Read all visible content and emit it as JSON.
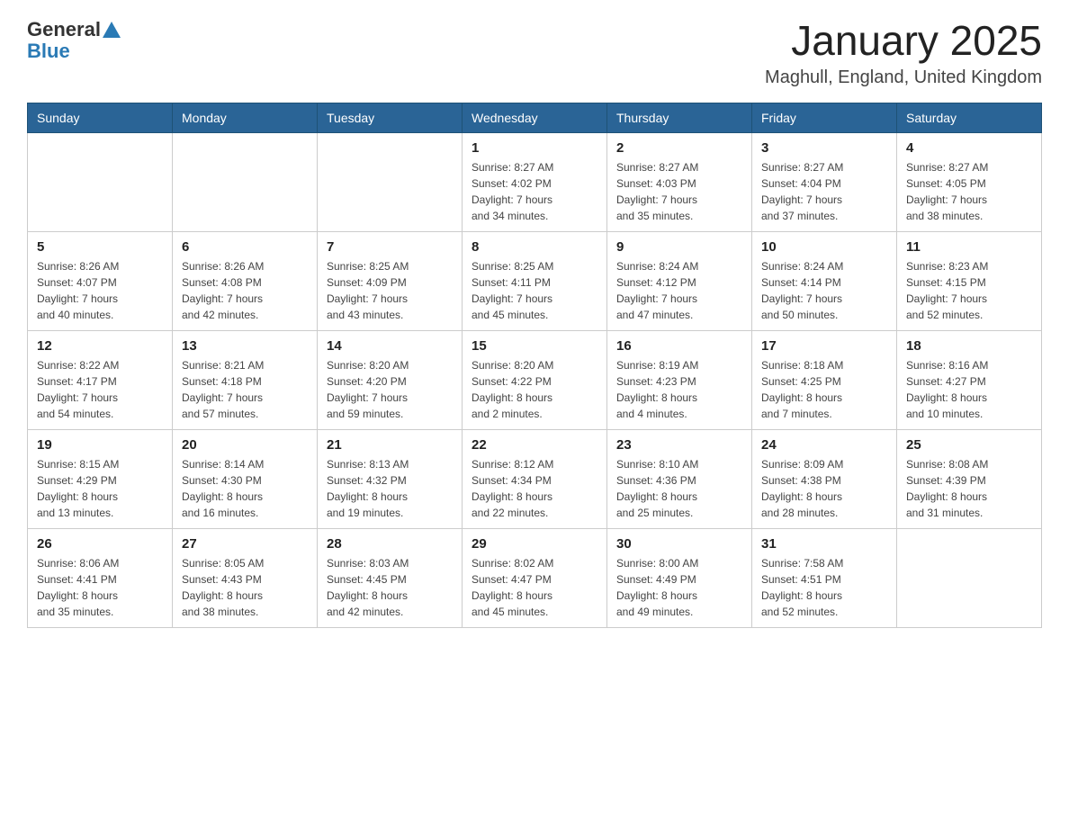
{
  "header": {
    "logo_general": "General",
    "logo_blue": "Blue",
    "title": "January 2025",
    "subtitle": "Maghull, England, United Kingdom"
  },
  "columns": [
    "Sunday",
    "Monday",
    "Tuesday",
    "Wednesday",
    "Thursday",
    "Friday",
    "Saturday"
  ],
  "weeks": [
    {
      "days": [
        {
          "number": "",
          "info": ""
        },
        {
          "number": "",
          "info": ""
        },
        {
          "number": "",
          "info": ""
        },
        {
          "number": "1",
          "info": "Sunrise: 8:27 AM\nSunset: 4:02 PM\nDaylight: 7 hours\nand 34 minutes."
        },
        {
          "number": "2",
          "info": "Sunrise: 8:27 AM\nSunset: 4:03 PM\nDaylight: 7 hours\nand 35 minutes."
        },
        {
          "number": "3",
          "info": "Sunrise: 8:27 AM\nSunset: 4:04 PM\nDaylight: 7 hours\nand 37 minutes."
        },
        {
          "number": "4",
          "info": "Sunrise: 8:27 AM\nSunset: 4:05 PM\nDaylight: 7 hours\nand 38 minutes."
        }
      ]
    },
    {
      "days": [
        {
          "number": "5",
          "info": "Sunrise: 8:26 AM\nSunset: 4:07 PM\nDaylight: 7 hours\nand 40 minutes."
        },
        {
          "number": "6",
          "info": "Sunrise: 8:26 AM\nSunset: 4:08 PM\nDaylight: 7 hours\nand 42 minutes."
        },
        {
          "number": "7",
          "info": "Sunrise: 8:25 AM\nSunset: 4:09 PM\nDaylight: 7 hours\nand 43 minutes."
        },
        {
          "number": "8",
          "info": "Sunrise: 8:25 AM\nSunset: 4:11 PM\nDaylight: 7 hours\nand 45 minutes."
        },
        {
          "number": "9",
          "info": "Sunrise: 8:24 AM\nSunset: 4:12 PM\nDaylight: 7 hours\nand 47 minutes."
        },
        {
          "number": "10",
          "info": "Sunrise: 8:24 AM\nSunset: 4:14 PM\nDaylight: 7 hours\nand 50 minutes."
        },
        {
          "number": "11",
          "info": "Sunrise: 8:23 AM\nSunset: 4:15 PM\nDaylight: 7 hours\nand 52 minutes."
        }
      ]
    },
    {
      "days": [
        {
          "number": "12",
          "info": "Sunrise: 8:22 AM\nSunset: 4:17 PM\nDaylight: 7 hours\nand 54 minutes."
        },
        {
          "number": "13",
          "info": "Sunrise: 8:21 AM\nSunset: 4:18 PM\nDaylight: 7 hours\nand 57 minutes."
        },
        {
          "number": "14",
          "info": "Sunrise: 8:20 AM\nSunset: 4:20 PM\nDaylight: 7 hours\nand 59 minutes."
        },
        {
          "number": "15",
          "info": "Sunrise: 8:20 AM\nSunset: 4:22 PM\nDaylight: 8 hours\nand 2 minutes."
        },
        {
          "number": "16",
          "info": "Sunrise: 8:19 AM\nSunset: 4:23 PM\nDaylight: 8 hours\nand 4 minutes."
        },
        {
          "number": "17",
          "info": "Sunrise: 8:18 AM\nSunset: 4:25 PM\nDaylight: 8 hours\nand 7 minutes."
        },
        {
          "number": "18",
          "info": "Sunrise: 8:16 AM\nSunset: 4:27 PM\nDaylight: 8 hours\nand 10 minutes."
        }
      ]
    },
    {
      "days": [
        {
          "number": "19",
          "info": "Sunrise: 8:15 AM\nSunset: 4:29 PM\nDaylight: 8 hours\nand 13 minutes."
        },
        {
          "number": "20",
          "info": "Sunrise: 8:14 AM\nSunset: 4:30 PM\nDaylight: 8 hours\nand 16 minutes."
        },
        {
          "number": "21",
          "info": "Sunrise: 8:13 AM\nSunset: 4:32 PM\nDaylight: 8 hours\nand 19 minutes."
        },
        {
          "number": "22",
          "info": "Sunrise: 8:12 AM\nSunset: 4:34 PM\nDaylight: 8 hours\nand 22 minutes."
        },
        {
          "number": "23",
          "info": "Sunrise: 8:10 AM\nSunset: 4:36 PM\nDaylight: 8 hours\nand 25 minutes."
        },
        {
          "number": "24",
          "info": "Sunrise: 8:09 AM\nSunset: 4:38 PM\nDaylight: 8 hours\nand 28 minutes."
        },
        {
          "number": "25",
          "info": "Sunrise: 8:08 AM\nSunset: 4:39 PM\nDaylight: 8 hours\nand 31 minutes."
        }
      ]
    },
    {
      "days": [
        {
          "number": "26",
          "info": "Sunrise: 8:06 AM\nSunset: 4:41 PM\nDaylight: 8 hours\nand 35 minutes."
        },
        {
          "number": "27",
          "info": "Sunrise: 8:05 AM\nSunset: 4:43 PM\nDaylight: 8 hours\nand 38 minutes."
        },
        {
          "number": "28",
          "info": "Sunrise: 8:03 AM\nSunset: 4:45 PM\nDaylight: 8 hours\nand 42 minutes."
        },
        {
          "number": "29",
          "info": "Sunrise: 8:02 AM\nSunset: 4:47 PM\nDaylight: 8 hours\nand 45 minutes."
        },
        {
          "number": "30",
          "info": "Sunrise: 8:00 AM\nSunset: 4:49 PM\nDaylight: 8 hours\nand 49 minutes."
        },
        {
          "number": "31",
          "info": "Sunrise: 7:58 AM\nSunset: 4:51 PM\nDaylight: 8 hours\nand 52 minutes."
        },
        {
          "number": "",
          "info": ""
        }
      ]
    }
  ]
}
